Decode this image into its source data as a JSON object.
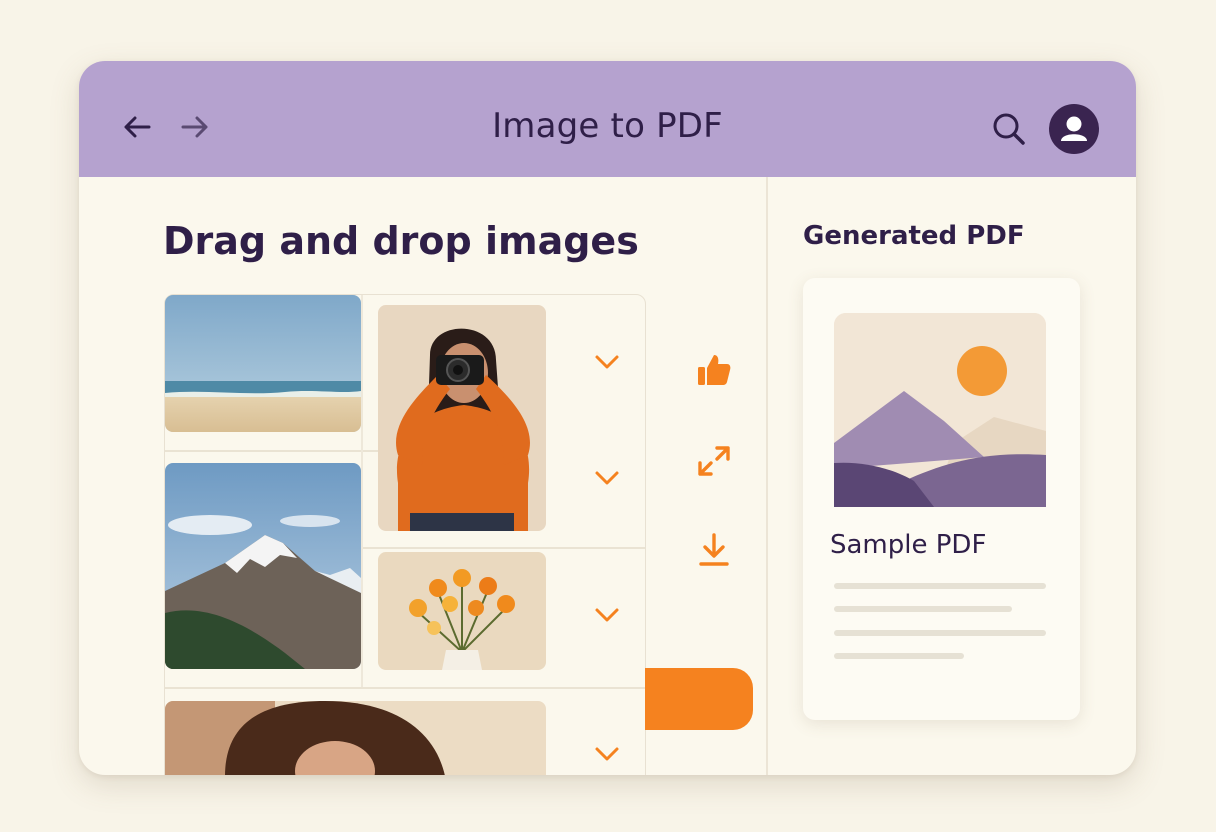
{
  "header": {
    "title": "Image to PDF",
    "back_icon": "arrow-left-icon",
    "forward_icon": "arrow-right-icon",
    "search_icon": "search-icon",
    "avatar_icon": "user-avatar-icon"
  },
  "upload": {
    "heading": "Drag and drop images",
    "images": [
      {
        "name": "beach",
        "kind": "photo"
      },
      {
        "name": "photographer",
        "kind": "photo"
      },
      {
        "name": "mountain",
        "kind": "photo"
      },
      {
        "name": "flowers",
        "kind": "photo"
      },
      {
        "name": "woman-portrait",
        "kind": "photo"
      }
    ],
    "actions": [
      "thumbs-up-icon",
      "expand-arrows-icon",
      "download-icon"
    ]
  },
  "output": {
    "heading": "Generated PDF",
    "file_name": "Sample PDF"
  },
  "colors": {
    "header_bg": "#b5a2cf",
    "accent": "#f5821f",
    "text_dark": "#2f1f48",
    "background": "#fbf8ed"
  }
}
